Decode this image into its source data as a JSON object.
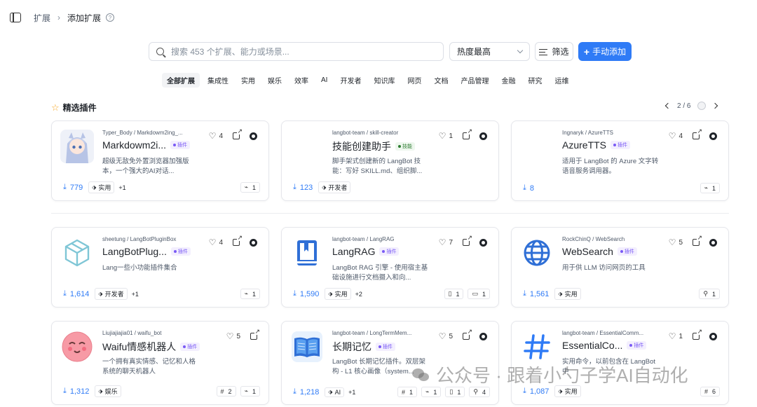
{
  "breadcrumb": {
    "parent": "扩展",
    "separator": "›",
    "current": "添加扩展"
  },
  "search": {
    "placeholder": "搜索 453 个扩展、能力或场景..."
  },
  "sort": {
    "selected": "热度最高"
  },
  "filter_label": "筛选",
  "add_label": "手动添加",
  "categories": [
    "全部扩展",
    "集成性",
    "实用",
    "娱乐",
    "效率",
    "AI",
    "开发者",
    "知识库",
    "网页",
    "文档",
    "产品管理",
    "金融",
    "研究",
    "运维"
  ],
  "featured": {
    "title": "精选插件",
    "page": "2 / 6"
  },
  "colors": {
    "accent": "#2f7bf6",
    "plugin_badge": "#7a5af5",
    "skill_badge": "#2e7d32"
  },
  "cards": [
    {
      "author": "Typer_Body / Markdowm2ing_...",
      "name": "Markdowm2i...",
      "badge": "插件",
      "desc": "超级无敌免外置浏览器加强版本，一个强大的AI对话...",
      "likes": "4",
      "downloads": "779",
      "tag": "实用",
      "more": "+1",
      "comps": [
        {
          "icon": "⌁",
          "n": "1"
        }
      ],
      "thumb": "anime-girl"
    },
    {
      "author": "langbot-team / skill-creator",
      "name": "技能创建助手",
      "badge": "技能",
      "desc": "脚手架式创建新的 LangBot 技能：写好 SKILL.md、组织脚...",
      "likes": "1",
      "downloads": "123",
      "tag": "开发者",
      "more": "",
      "comps": [],
      "thumb": "none"
    },
    {
      "author": "Ingnaryk / AzureTTS",
      "name": "AzureTTS",
      "badge": "插件",
      "desc": "适用于 LangBot 的 Azure 文字转语音服务调用器。",
      "likes": "4",
      "downloads": "8",
      "tag": "",
      "more": "",
      "comps": [
        {
          "icon": "⌁",
          "n": "1"
        }
      ],
      "thumb": "none"
    },
    {
      "author": "sheetung / LangBotPluginBox",
      "name": "LangBotPlug...",
      "badge": "插件",
      "desc": "Lang一些小功能插件集合",
      "likes": "4",
      "downloads": "1,614",
      "tag": "开发者",
      "more": "+1",
      "comps": [
        {
          "icon": "⌁",
          "n": "1"
        }
      ],
      "thumb": "box"
    },
    {
      "author": "langbot-team / LangRAG",
      "name": "LangRAG",
      "badge": "插件",
      "desc": "LangBot RAG 引擎 - 使用宿主基础设施进行文档摄入和向...",
      "likes": "7",
      "downloads": "1,590",
      "tag": "实用",
      "more": "+2",
      "comps": [
        {
          "icon": "▯",
          "n": "1"
        },
        {
          "icon": "▭",
          "n": "1"
        }
      ],
      "thumb": "book"
    },
    {
      "author": "RockChinQ / WebSearch",
      "name": "WebSearch",
      "badge": "插件",
      "desc": "用于供 LLM 访问网页的工具",
      "likes": "5",
      "downloads": "1,561",
      "tag": "实用",
      "more": "",
      "comps": [
        {
          "icon": "⚲",
          "n": "1"
        }
      ],
      "thumb": "globe"
    },
    {
      "author": "Liujiajiajia01 / waifu_bot",
      "name": "Waifu情感机器人",
      "badge": "插件",
      "desc": "一个拥有真实情感、记忆和人格系统的聊天机器人",
      "likes": "5",
      "downloads": "1,312",
      "tag": "娱乐",
      "more": "",
      "comps": [
        {
          "icon": "#",
          "n": "2"
        },
        {
          "icon": "⌁",
          "n": "1"
        }
      ],
      "thumb": "smiley"
    },
    {
      "author": "langbot-team / LongTermMem...",
      "name": "长期记忆",
      "badge": "插件",
      "desc": "LangBot 长期记忆插件。双层架构 - L1 核心画像（system...",
      "likes": "5",
      "downloads": "1,218",
      "tag": "AI",
      "more": "+1",
      "comps": [
        {
          "icon": "#",
          "n": "1"
        },
        {
          "icon": "⌁",
          "n": "1"
        },
        {
          "icon": "▯",
          "n": "1"
        },
        {
          "icon": "⚲",
          "n": "4"
        }
      ],
      "thumb": "openbook"
    },
    {
      "author": "langbot-team / EssentialComm...",
      "name": "EssentialCo...",
      "badge": "插件",
      "desc": "实用命令，以前包含在 LangBot 中",
      "likes": "1",
      "downloads": "1,087",
      "tag": "实用",
      "more": "",
      "comps": [
        {
          "icon": "#",
          "n": "6"
        }
      ],
      "thumb": "hash"
    }
  ],
  "watermark": "公众号 · 跟着小勺子学AI自动化"
}
